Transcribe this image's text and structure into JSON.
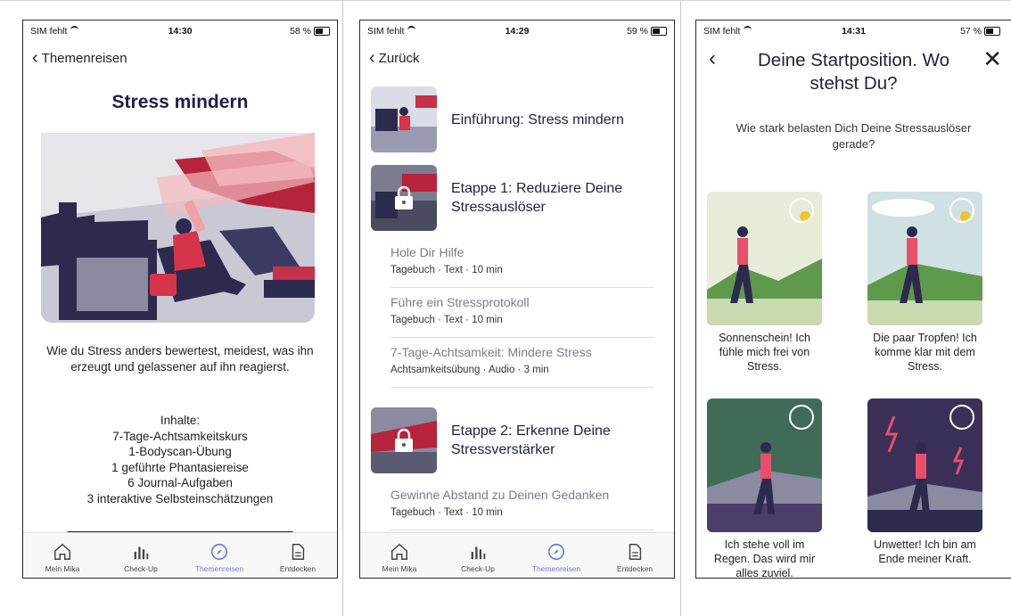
{
  "status": {
    "screen1": {
      "carrier": "SIM fehlt",
      "time": "14:30",
      "battery": "58 %"
    },
    "screen2": {
      "carrier": "SIM fehlt",
      "time": "14:29",
      "battery": "59 %"
    },
    "screen3": {
      "carrier": "SIM fehlt",
      "time": "14:31",
      "battery": "57 %"
    }
  },
  "tabbar": [
    {
      "label": "Mein Mika",
      "icon": "home-icon"
    },
    {
      "label": "Check-Up",
      "icon": "bar-chart-icon"
    },
    {
      "label": "Themenreisen",
      "icon": "compass-icon"
    },
    {
      "label": "Entdecken",
      "icon": "document-icon"
    }
  ],
  "active_tab_color": "#6f78e3",
  "screen1": {
    "back_label": "Themenreisen",
    "title": "Stress mindern",
    "description": "Wie du Stress anders bewertest, meidest, was ihn erzeugt und gelassener auf ihn reagierst.",
    "contents_heading": "Inhalte:",
    "contents": [
      "7-Tage-Achtsamkeitskurs",
      "1-Bodyscan-Übung",
      "1 geführte Phantasiereise",
      "6 Journal-Aufgaben",
      "3 interaktive Selbsteinschätzungen"
    ]
  },
  "screen2": {
    "back_label": "Zurück",
    "intro_title": "Einführung: Stress mindern",
    "etappe1_title": "Etappe 1: Reduziere Deine Stressauslöser",
    "lessons1": [
      {
        "title": "Hole Dir Hilfe",
        "meta": "Tagebuch · Text · 10 min"
      },
      {
        "title": "Führe ein Stressprotokoll",
        "meta": "Tagebuch · Text · 10 min"
      },
      {
        "title": "7-Tage-Achtsamkeit: Mindere Stress",
        "meta": "Achtsamkeitsübung · Audio · 3 min"
      }
    ],
    "etappe2_title": "Etappe 2: Erkenne Deine Stressverstärker",
    "lessons2": [
      {
        "title": "Gewinne Abstand zu Deinen Gedanken",
        "meta": "Tagebuch · Text · 10 min"
      }
    ]
  },
  "screen3": {
    "title": "Deine Startposition. Wo stehst Du?",
    "question": "Wie stark belasten Dich Deine Stressauslöser gerade?",
    "options": [
      {
        "caption": "Sonnenschein! Ich fühle mich frei von Stress."
      },
      {
        "caption": "Die paar Tropfen! Ich komme klar mit dem Stress."
      },
      {
        "caption": "Ich stehe voll im Regen. Das wird mir alles zuviel."
      },
      {
        "caption": "Unwetter! Ich bin am Ende meiner Kraft."
      }
    ]
  }
}
